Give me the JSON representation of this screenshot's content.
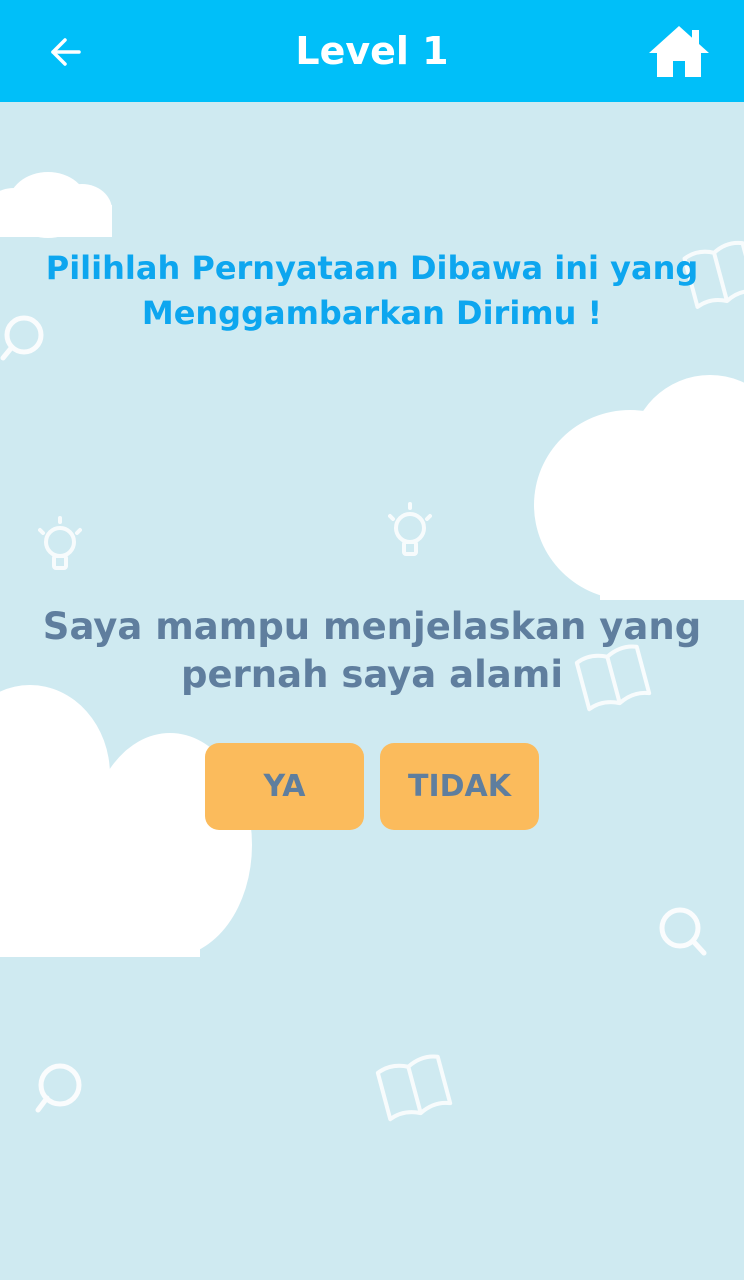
{
  "header": {
    "title": "Level 1",
    "back_icon": "arrow-left-icon",
    "home_icon": "home-icon",
    "background_color": "#00bff9"
  },
  "content": {
    "instruction": "Pilihlah Pernyataan Dibawa ini yang Menggambarkan Dirimu !",
    "statement": "Saya mampu menjelaskan yang pernah saya alami"
  },
  "answers": {
    "yes_label": "YA",
    "no_label": "TIDAK",
    "button_color": "#fbbb5c"
  },
  "theme": {
    "background": "#cfeaf1",
    "instruction_color": "#0da6ef",
    "statement_color": "#5f7e9e"
  },
  "decorations": [
    "cloud",
    "magnifier-icon",
    "lightbulb-icon",
    "book-icon"
  ]
}
